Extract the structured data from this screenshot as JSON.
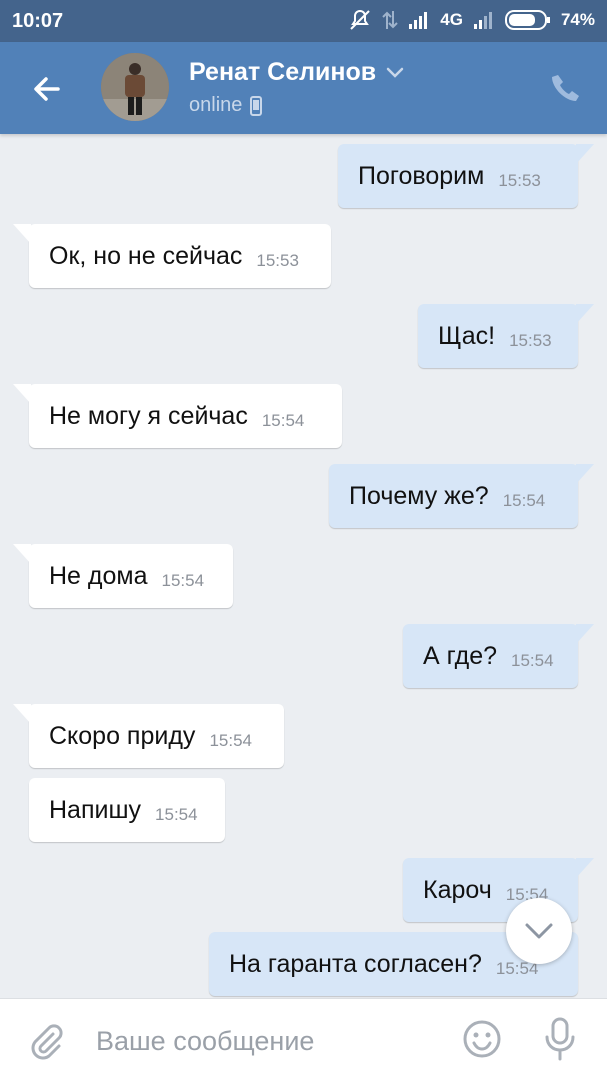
{
  "status_bar": {
    "time": "10:07",
    "network": "4G",
    "battery": "74%"
  },
  "header": {
    "contact_name": "Ренат Селинов",
    "presence": "online"
  },
  "messages": [
    {
      "direction": "out",
      "text": "Поговорим",
      "time": "15:53"
    },
    {
      "direction": "in",
      "text": "Ок, но не сейчас",
      "time": "15:53"
    },
    {
      "direction": "out",
      "text": "Щас!",
      "time": "15:53"
    },
    {
      "direction": "in",
      "text": "Не могу я сейчас",
      "time": "15:54"
    },
    {
      "direction": "out",
      "text": "Почему же?",
      "time": "15:54"
    },
    {
      "direction": "in",
      "text": "Не дома",
      "time": "15:54"
    },
    {
      "direction": "out",
      "text": "А где?",
      "time": "15:54"
    },
    {
      "direction": "in",
      "text": "Скоро приду",
      "time": "15:54"
    },
    {
      "direction": "in",
      "text": "Напишу",
      "time": "15:54"
    },
    {
      "direction": "out",
      "text": "Кароч",
      "time": "15:54"
    },
    {
      "direction": "out",
      "text": "На гаранта согласен?",
      "time": "15:54"
    }
  ],
  "composer": {
    "placeholder": "Ваше сообщение"
  },
  "icons": {
    "back": "arrow-left-icon",
    "dropdown": "chevron-down-icon",
    "mobile": "mobile-phone-icon",
    "call": "phone-icon",
    "scroll_down": "chevron-down-icon",
    "attach": "paperclip-icon",
    "emoji": "smile-icon",
    "mic": "microphone-icon"
  },
  "colors": {
    "header": "#5181b8",
    "status_bar": "#44648c",
    "background": "#ebeef2",
    "incoming_bubble": "#ffffff",
    "outgoing_bubble": "#d7e6f7"
  }
}
